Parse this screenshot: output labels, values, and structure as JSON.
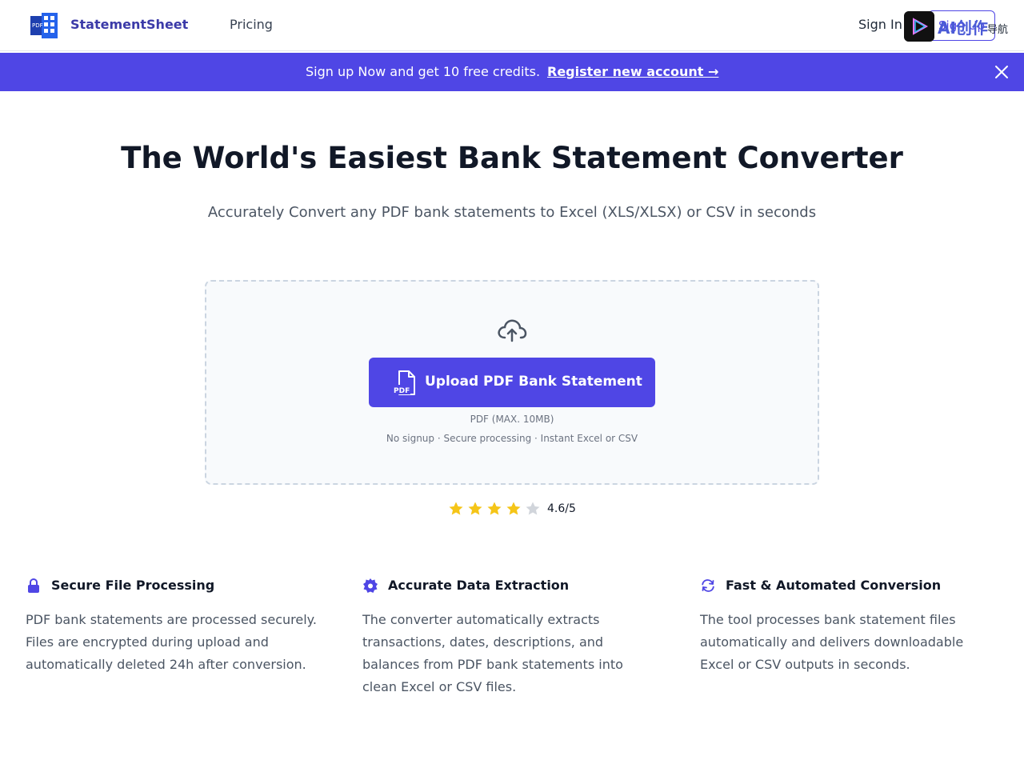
{
  "header": {
    "brand": "StatementSheet",
    "nav_pricing": "Pricing",
    "sign_in": "Sign In",
    "sign_up": "Sign Up",
    "logo_label": "PDF",
    "watermark_text": "AI创作",
    "watermark_sub": "导航"
  },
  "banner": {
    "text": "Sign up Now and get 10 free credits.",
    "link": "Register new account →"
  },
  "hero": {
    "title": "The World's Easiest Bank Statement Converter",
    "subtitle": "Accurately Convert any PDF bank statements to Excel (XLS/XLSX) or CSV in seconds"
  },
  "upload": {
    "button_label": "Upload PDF Bank Statement",
    "pdf_icon_label": "PDF",
    "limit": "PDF (MAX. 10MB)",
    "trust": "No signup · Secure processing · Instant Excel or CSV"
  },
  "rating": {
    "value": 4.6,
    "max": 5,
    "text": "4.6/5",
    "filled_stars": 4
  },
  "features": [
    {
      "icon": "lock-icon",
      "title": "Secure File Processing",
      "description": "PDF bank statements are processed securely. Files are encrypted during upload and automatically deleted 24h after conversion."
    },
    {
      "icon": "gear-icon",
      "title": "Accurate Data Extraction",
      "description": "The converter automatically extracts transactions, dates, descriptions, and balances from PDF bank statements into clean Excel or CSV files."
    },
    {
      "icon": "refresh-icon",
      "title": "Fast & Automated Conversion",
      "description": "The tool processes bank statement files automatically and delivers downloadable Excel or CSV outputs in seconds."
    }
  ],
  "colors": {
    "primary": "#4f46e5",
    "brand_text": "#3b3aa8",
    "star_filled": "#f5c518",
    "star_empty": "#d1d5db"
  }
}
